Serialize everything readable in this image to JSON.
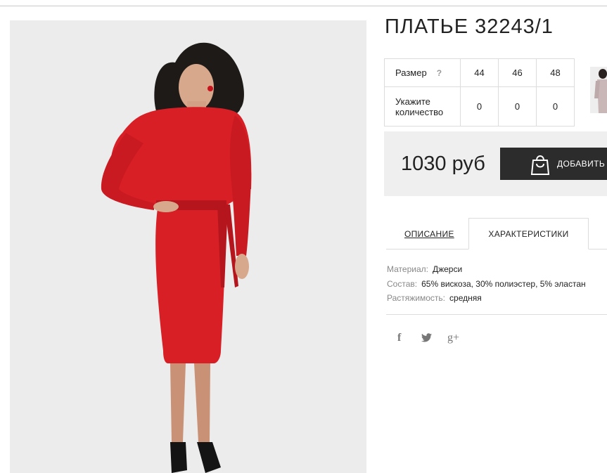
{
  "product": {
    "title": "ПЛАТЬЕ 32243/1",
    "size_label": "Размер",
    "size_help": "?",
    "sizes": [
      "44",
      "46",
      "48"
    ],
    "qty_label_line1": "Укажите",
    "qty_label_line2": "количество",
    "quantities": [
      "0",
      "0",
      "0"
    ],
    "price": "1030 руб",
    "add_button": "ДОБАВИТЬ"
  },
  "tabs": {
    "description": "ОПИСАНИЕ",
    "characteristics": "ХАРАКТЕРИСТИКИ"
  },
  "characteristics": [
    {
      "key": "Материал:",
      "value": "Джерси"
    },
    {
      "key": "Состав:",
      "value": "65% вискоза, 30% полиэстер, 5% эластан"
    },
    {
      "key": "Растяжимость:",
      "value": "средняя"
    }
  ],
  "social": {
    "facebook": "f",
    "twitter": "twitter-icon",
    "googleplus": "g+"
  },
  "colors": {
    "dress": "#d81f26",
    "button": "#2c2c2c",
    "price_bg": "#efefef",
    "photo_bg": "#ececed"
  }
}
